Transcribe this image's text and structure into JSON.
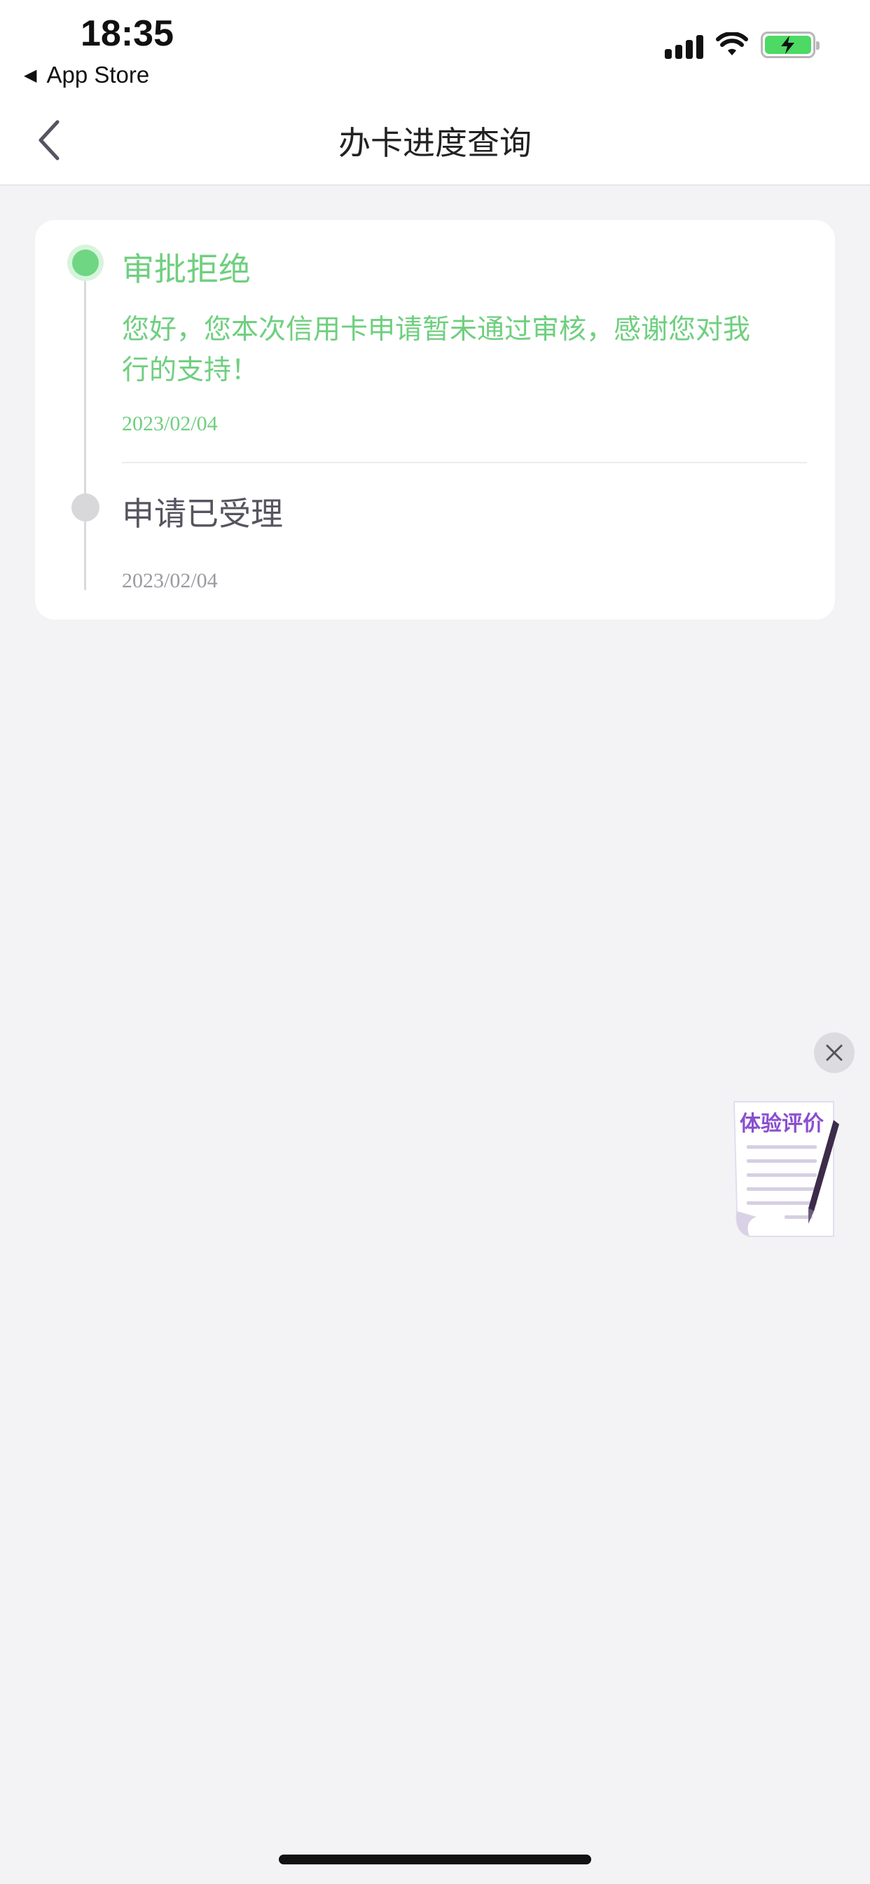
{
  "status_bar": {
    "time": "18:35",
    "back_app": "App Store",
    "back_glyph": "◀"
  },
  "nav": {
    "title": "办卡进度查询"
  },
  "timeline": [
    {
      "title": "审批拒绝",
      "description": "您好，您本次信用卡申请暂未通过审核，感谢您对我行的支持！",
      "date": "2023/02/04",
      "status": "active"
    },
    {
      "title": "申请已受理",
      "date": "2023/02/04",
      "status": "done"
    }
  ],
  "feedback_widget": {
    "label": "体验评价"
  },
  "colors": {
    "accent_green": "#6fcf7f",
    "background": "#f3f3f6",
    "feedback_purple": "#8a4fcf"
  }
}
